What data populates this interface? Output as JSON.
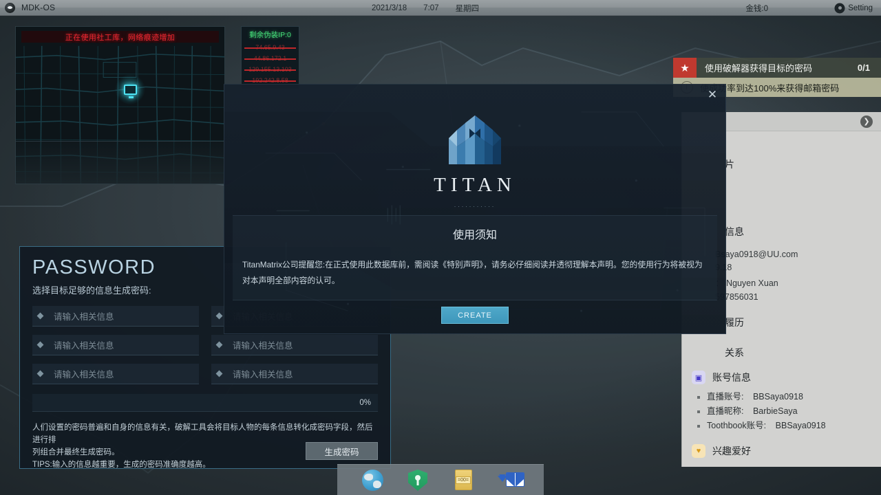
{
  "topbar": {
    "logo_icon": "eye-logo-icon",
    "title": "MDK-OS",
    "date": "2021/3/18",
    "time": "7:07",
    "weekday": "星期四",
    "money": "金钱:0",
    "setting_label": "Setting",
    "setting_icon": "gear-icon"
  },
  "map_widget": {
    "warning": "正在使用社工库，网络痕迹增加",
    "node_icon": "monitor-node-icon"
  },
  "ip_panel": {
    "title": "剩余伪装IP:0",
    "ips": [
      "74.65.9.43",
      "44.86.172.1",
      "129.155.13.103",
      "192.242.8.58"
    ]
  },
  "quests": {
    "primary": {
      "icon": "star-icon",
      "label": "使用破解器获得目标的密码",
      "count": "0/1"
    },
    "secondary": {
      "icon": "clock-icon",
      "label": "使成功率到达100%来获得邮箱密码"
    }
  },
  "sidebar": {
    "expand_icon": "chevron-right-icon",
    "fragment_photo": "片",
    "section_info_title": "信息",
    "info_lines": [
      "Bsaya0918@UU.com",
      "9.18",
      "：  Nguyen Xuan",
      "597856031"
    ],
    "section_resume_title": "履历",
    "section_relation_title": "关系",
    "account_group": {
      "icon": "account-card-icon",
      "title": "账号信息",
      "items": [
        {
          "key": "直播账号:",
          "value": "BBSaya0918"
        },
        {
          "key": "直播昵称:",
          "value": "BarbieSaya"
        },
        {
          "key": "Toothbook账号:",
          "value": "BBSaya0918"
        }
      ]
    },
    "hobby_group": {
      "icon": "heart-icon",
      "title": "兴趣爱好"
    }
  },
  "password_panel": {
    "title": "PASSWORD",
    "subtitle": "选择目标足够的信息生成密码:",
    "field_placeholder": "请输入相关信息",
    "fields": [
      {
        "value": "",
        "placeholder": "请输入相关信息"
      },
      {
        "value": "",
        "placeholder": "请输入相关信息"
      },
      {
        "value": "",
        "placeholder": "请输入相关信息"
      },
      {
        "value": "",
        "placeholder": "请输入相关信息"
      },
      {
        "value": "",
        "placeholder": "请输入相关信息"
      },
      {
        "value": "",
        "placeholder": "请输入相关信息"
      }
    ],
    "progress_percent": "0%",
    "progress_value": 0,
    "description_line1": "人们设置的密码普遍和自身的信息有关，破解工具会将目标人物的每条信息转化成密码字段，然后进行排",
    "description_line2": "列组合并最终生成密码。",
    "description_line3": "TIPS:输入的信息越重要，生成的密码准确度越高。",
    "generate_button": "生成密码"
  },
  "modal": {
    "close_icon": "close-icon",
    "logo_icon": "titan-tower-logo-icon",
    "wordmark": "TITAN",
    "dots": "...........",
    "notice_title": "使用须知",
    "notice_body": "TitanMatrix公司提醒您:在正式使用此数据库前，需阅读《特别声明》，请务必仔细阅读并透彻理解本声明。您的使用行为将被视为对本声明全部内容的认可。",
    "create_button": "CREATE"
  },
  "taskbar": {
    "items": [
      {
        "icon": "globe-browser-icon",
        "name": "browser"
      },
      {
        "icon": "shield-key-icon",
        "name": "password-tool"
      },
      {
        "icon": "yellow-note-icon",
        "name": "notes",
        "badge": "=00="
      },
      {
        "icon": "mail-icon",
        "name": "mail"
      }
    ]
  },
  "colors": {
    "accent_blue": "#4fa8c9",
    "danger_red": "#c0272b",
    "quest_red": "#c0392f",
    "green": "#46e07a",
    "panel_border": "#3a6d86"
  }
}
